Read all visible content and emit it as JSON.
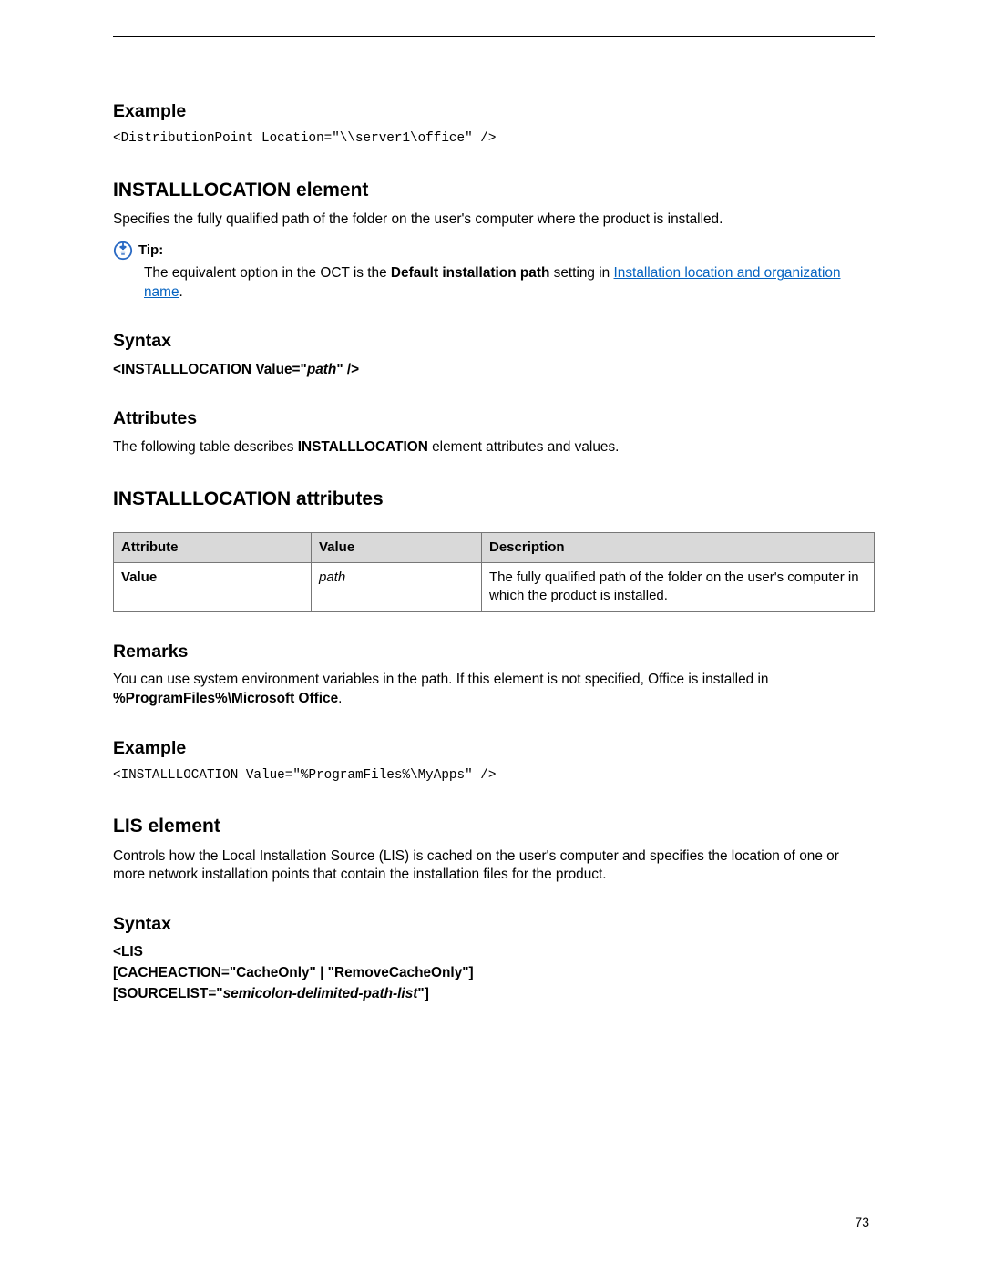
{
  "page_number": "73",
  "sections": {
    "example1": {
      "title": "Example",
      "code": "<DistributionPoint Location=\"\\\\server1\\office\" />"
    },
    "installlocation": {
      "title": "INSTALLLOCATION element",
      "desc": "Specifies the fully qualified path of the folder on the user's computer where the product is installed.",
      "tip_label": "Tip:",
      "tip_prefix": "The equivalent option in the OCT is the ",
      "tip_bold": "Default installation path",
      "tip_middle": " setting in ",
      "tip_link": "Installation location and organization name",
      "tip_suffix": "."
    },
    "syntax1": {
      "title": "Syntax",
      "prefix": "<INSTALLLOCATION Value=\"",
      "italic": "path",
      "suffix": "\" />"
    },
    "attributes": {
      "title": "Attributes",
      "desc_before": "The following table describes ",
      "desc_bold": "INSTALLLOCATION",
      "desc_after": " element attributes and values."
    },
    "attrtable": {
      "title": "INSTALLLOCATION attributes",
      "headers": {
        "c1": "Attribute",
        "c2": "Value",
        "c3": "Description"
      },
      "row": {
        "attr": "Value",
        "value": "path",
        "desc": "The fully qualified path of the folder on the user's computer in which the product is installed."
      }
    },
    "remarks": {
      "title": "Remarks",
      "text_before": "You can use system environment variables in the path. If this element is not specified, Office is installed in ",
      "text_bold": "%ProgramFiles%\\Microsoft Office",
      "text_after": "."
    },
    "example2": {
      "title": "Example",
      "code": "<INSTALLLOCATION Value=\"%ProgramFiles%\\MyApps\" />"
    },
    "lis": {
      "title": "LIS element",
      "desc": "Controls how the Local Installation Source (LIS) is cached on the user's computer and specifies the location of one or more network installation points that contain the installation files for the product."
    },
    "syntax2": {
      "title": "Syntax",
      "line1": "<LIS",
      "line2": "[CACHEACTION=\"CacheOnly\" | \"RemoveCacheOnly\"]",
      "line3_prefix": "[SOURCELIST=\"",
      "line3_italic": "semicolon-delimited-path-list",
      "line3_suffix": "\"]"
    }
  }
}
